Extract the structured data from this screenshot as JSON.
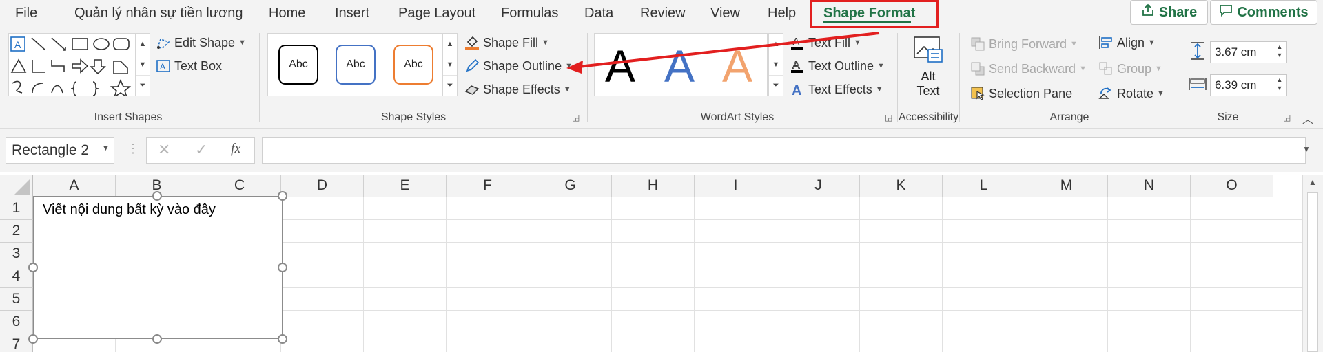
{
  "tabs": [
    "File",
    "Quản lý nhân sự tiền lương",
    "Home",
    "Insert",
    "Page Layout",
    "Formulas",
    "Data",
    "Review",
    "View",
    "Help",
    "Shape Format"
  ],
  "active_tab": "Shape Format",
  "top_buttons": {
    "share": "Share",
    "comments": "Comments"
  },
  "insert_shapes": {
    "edit_shape": "Edit Shape",
    "text_box": "Text Box",
    "group_label": "Insert Shapes"
  },
  "shape_styles": {
    "swatches": [
      "Abc",
      "Abc",
      "Abc"
    ],
    "shape_fill": "Shape Fill",
    "shape_outline": "Shape Outline",
    "shape_effects": "Shape Effects",
    "group_label": "Shape Styles"
  },
  "wordart": {
    "letters": [
      "A",
      "A",
      "A"
    ],
    "text_fill": "Text Fill",
    "text_outline": "Text Outline",
    "text_effects": "Text Effects",
    "group_label": "WordArt Styles"
  },
  "accessibility": {
    "alt_line1": "Alt",
    "alt_line2": "Text",
    "group_label": "Accessibility"
  },
  "arrange": {
    "bring_forward": "Bring Forward",
    "send_backward": "Send Backward",
    "selection_pane": "Selection Pane",
    "align": "Align",
    "group": "Group",
    "rotate": "Rotate",
    "group_label": "Arrange"
  },
  "size": {
    "height": "3.67 cm",
    "width": "6.39 cm",
    "group_label": "Size"
  },
  "formula_bar": {
    "name_box": "Rectangle 2",
    "fx": "fx",
    "cancel": "✕",
    "enter": "✓",
    "formula": ""
  },
  "columns": [
    "A",
    "B",
    "C",
    "D",
    "E",
    "F",
    "G",
    "H",
    "I",
    "J",
    "K",
    "L",
    "M",
    "N",
    "O"
  ],
  "rows": [
    "1",
    "2",
    "3",
    "4",
    "5",
    "6",
    "7"
  ],
  "shape_text": "Viết nội dung bất kỳ vào đây",
  "colors": {
    "accent": "#217346",
    "highlight": "#e21f1f",
    "style_black": "#000000",
    "style_blue": "#4472c4",
    "style_orange": "#ed7d31"
  }
}
